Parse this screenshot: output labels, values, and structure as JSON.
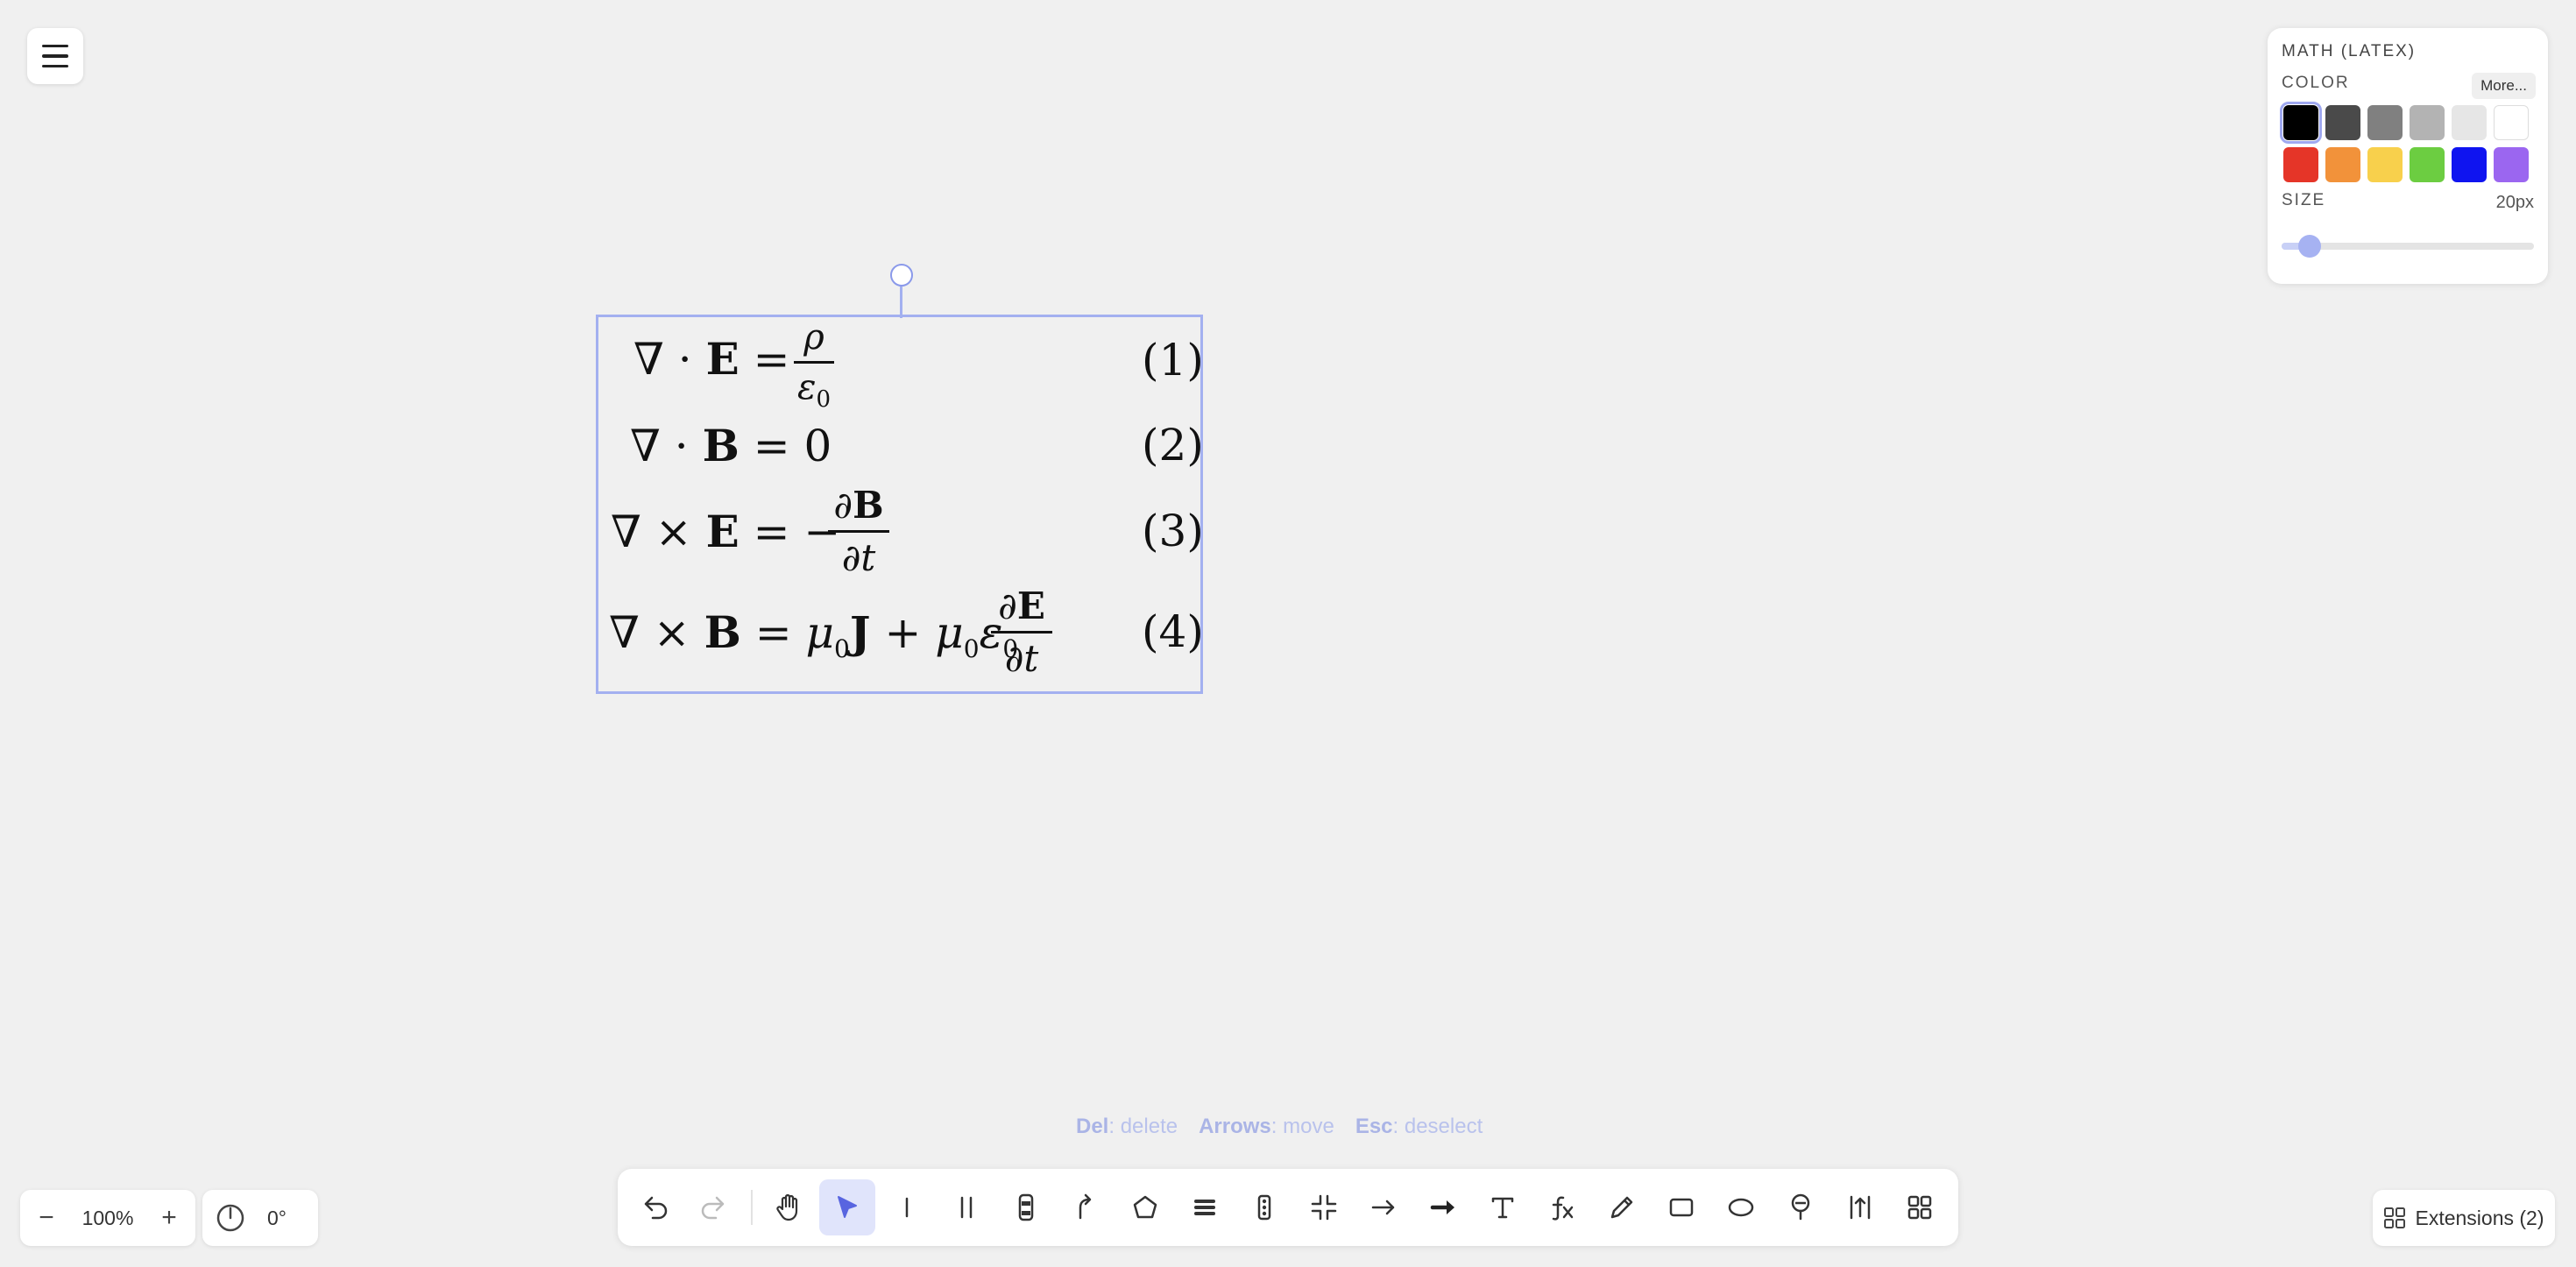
{
  "menu": {
    "icon": "hamburger-icon"
  },
  "equations": [
    {
      "lhs": "∇ · E",
      "rhs": "ρ / ε0",
      "number": "(1)"
    },
    {
      "lhs": "∇ · B",
      "rhs": "0",
      "number": "(2)"
    },
    {
      "lhs": "∇ × E",
      "rhs": "− ∂B / ∂t",
      "number": "(3)"
    },
    {
      "lhs": "∇ × B",
      "rhs": "μ0J + μ0ε0 ∂E / ∂t",
      "number": "(4)"
    }
  ],
  "panel": {
    "title": "MATH (LATEX)",
    "color_label": "COLOR",
    "more_label": "More...",
    "colors": [
      "#000000",
      "#4a4a4a",
      "#808080",
      "#b3b3b3",
      "#e6e6e6",
      "#ffffff",
      "#e53528",
      "#f2923a",
      "#f8d04c",
      "#6ccd41",
      "#0f14f0",
      "#9b66f0"
    ],
    "selected_color": "#000000",
    "size_label": "SIZE",
    "size_value": "20px",
    "size_fraction": 0.11
  },
  "hint": {
    "del_key": "Del",
    "del_text": ": delete",
    "arrows_key": "Arrows",
    "arrows_text": ": move",
    "esc_key": "Esc",
    "esc_text": ": deselect"
  },
  "zoom": {
    "minus": "−",
    "value": "100%",
    "plus": "+"
  },
  "rotation": {
    "icon": "compass-icon",
    "value": "0°"
  },
  "toolbar": {
    "tools": [
      "undo",
      "redo",
      "hand",
      "select",
      "line",
      "double-line",
      "car",
      "curved-arrow",
      "polygon",
      "thick-lines",
      "traffic-light",
      "compress",
      "arrow",
      "bold-arrow",
      "text",
      "math",
      "pencil",
      "rectangle",
      "ellipse",
      "pin",
      "measure",
      "grid"
    ],
    "active": "select"
  },
  "extensions": {
    "label": "Extensions (2)"
  }
}
